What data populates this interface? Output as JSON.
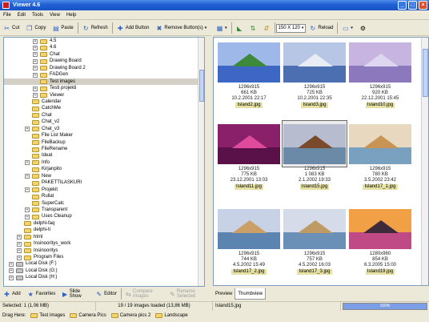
{
  "window": {
    "title": "Viewer 4.6"
  },
  "menu": [
    "File",
    "Edit",
    "Tools",
    "View",
    "Help"
  ],
  "toolbar_left": [
    {
      "label": "Cut",
      "icon": "scissors-icon",
      "glyph": "✂"
    },
    {
      "label": "Copy",
      "icon": "copy-icon",
      "glyph": "❐"
    },
    {
      "label": "Paste",
      "icon": "paste-icon",
      "glyph": "▤"
    },
    {
      "label": "Refresh",
      "icon": "refresh-icon",
      "glyph": "↻"
    },
    {
      "label": "Add Button",
      "icon": "add-button-icon",
      "glyph": "✚"
    },
    {
      "label": "Remove Button(s)",
      "icon": "remove-button-icon",
      "glyph": "✖"
    }
  ],
  "toolbar_right": {
    "size": "150 X 120",
    "reload": "Reload"
  },
  "tree": [
    {
      "label": "4.5",
      "lvl": 3,
      "exp": "+"
    },
    {
      "label": "4.6",
      "lvl": 3,
      "exp": "+"
    },
    {
      "label": "Chat",
      "lvl": 3,
      "exp": "+"
    },
    {
      "label": "Drawing Board",
      "lvl": 3,
      "exp": "+"
    },
    {
      "label": "Drawing Board 2",
      "lvl": 3,
      "exp": "+"
    },
    {
      "label": "FADGen",
      "lvl": 3,
      "exp": "+"
    },
    {
      "label": "Test images",
      "lvl": 3,
      "exp": "",
      "selected": true
    },
    {
      "label": "Testi projekti",
      "lvl": 3,
      "exp": "+"
    },
    {
      "label": "Viewer",
      "lvl": 3,
      "exp": "+"
    },
    {
      "label": "Calendar",
      "lvl": 2,
      "exp": ""
    },
    {
      "label": "CatchMe",
      "lvl": 2,
      "exp": ""
    },
    {
      "label": "Chat",
      "lvl": 2,
      "exp": ""
    },
    {
      "label": "Chat_v2",
      "lvl": 2,
      "exp": ""
    },
    {
      "label": "Chat_v3",
      "lvl": 2,
      "exp": "+"
    },
    {
      "label": "File List Maker",
      "lvl": 2,
      "exp": ""
    },
    {
      "label": "FileBackup",
      "lvl": 2,
      "exp": ""
    },
    {
      "label": "FileRename",
      "lvl": 2,
      "exp": ""
    },
    {
      "label": "Ideat",
      "lvl": 2,
      "exp": ""
    },
    {
      "label": "Info",
      "lvl": 2,
      "exp": "+"
    },
    {
      "label": "Kirjanpito",
      "lvl": 2,
      "exp": ""
    },
    {
      "label": "New",
      "lvl": 2,
      "exp": "+"
    },
    {
      "label": "PAKETTILASKURI",
      "lvl": 2,
      "exp": ""
    },
    {
      "label": "Projekit",
      "lvl": 2,
      "exp": "+"
    },
    {
      "label": "Rullat",
      "lvl": 2,
      "exp": ""
    },
    {
      "label": "SuperCalc",
      "lvl": 2,
      "exp": ""
    },
    {
      "label": "Transparent",
      "lvl": 2,
      "exp": "+"
    },
    {
      "label": "Uses Cleanup",
      "lvl": 2,
      "exp": "+"
    },
    {
      "label": "delphi-faq",
      "lvl": 1,
      "exp": ""
    },
    {
      "label": "delphi-ti",
      "lvl": 1,
      "exp": ""
    },
    {
      "label": "html",
      "lvl": 1,
      "exp": "+"
    },
    {
      "label": "Insinooritys_work",
      "lvl": 1,
      "exp": "+"
    },
    {
      "label": "Insinooritys",
      "lvl": 1,
      "exp": "+"
    },
    {
      "label": "Program Files",
      "lvl": 1,
      "exp": "+"
    },
    {
      "label": "Local Disk (F:)",
      "lvl": 0,
      "exp": "+",
      "drive": true
    },
    {
      "label": "Local Disk (G:)",
      "lvl": 0,
      "exp": "+",
      "drive": true
    },
    {
      "label": "Local Disk (H:)",
      "lvl": 0,
      "exp": "+",
      "drive": true
    }
  ],
  "thumbnails": [
    {
      "dims": "1296x915",
      "size": "661 KB",
      "date": "10.2.2001 22:17",
      "name": "Island2.jpg",
      "sky": "#9fb8ea",
      "sea": "#3e66c4",
      "land": "#3d8a3a"
    },
    {
      "dims": "1296x915",
      "size": "725 KB",
      "date": "10.2.2001 22:35",
      "name": "Island3.jpg",
      "sky": "#b8c6e6",
      "sea": "#4c6fb2",
      "land": "#e8ecf4"
    },
    {
      "dims": "1296x915",
      "size": "920 KB",
      "date": "22.12.2001 15:45",
      "name": "Island10.jpg",
      "sky": "#c8b4e0",
      "sea": "#8c78bc",
      "land": "#ddd6f0"
    },
    {
      "dims": "1296x915",
      "size": "775 KB",
      "date": "23.12.2001 13:03",
      "name": "Island11.jpg",
      "sky": "#8a1f6a",
      "sea": "#5a1048",
      "land": "#e04a9c"
    },
    {
      "dims": "1296x915",
      "size": "1 083 KB",
      "date": "2.1.2002 19:33",
      "name": "Island15.jpg",
      "sky": "#b7bccf",
      "sea": "#6a8aa8",
      "land": "#7a4a2a",
      "selected": true
    },
    {
      "dims": "1296x915",
      "size": "780 KB",
      "date": "3.5.2002 23:42",
      "name": "Island17_1.jpg",
      "sky": "#e9d8c0",
      "sea": "#7aa0c0",
      "land": "#c89454"
    },
    {
      "dims": "1296x915",
      "size": "744 KB",
      "date": "4.5.2002 15:49",
      "name": "Island17_2.jpg",
      "sky": "#c8d2e6",
      "sea": "#5c84b0",
      "land": "#caa066"
    },
    {
      "dims": "1296x915",
      "size": "757 KB",
      "date": "4.5.2002 16:03",
      "name": "Island17_3.jpg",
      "sky": "#d6dbea",
      "sea": "#6a90b8",
      "land": "#bf9a64"
    },
    {
      "dims": "1280x960",
      "size": "854 KB",
      "date": "6.3.2005 15:00",
      "name": "Island19.jpg",
      "sky": "#f2a046",
      "sea": "#c04a86",
      "land": "#3d2a3a"
    }
  ],
  "bottom_left": [
    {
      "label": "Add",
      "icon": "add-icon",
      "glyph": "✚",
      "disabled": false
    },
    {
      "label": "Favorites",
      "icon": "favorites-icon",
      "glyph": "★",
      "disabled": false
    },
    {
      "label": "Slide Show",
      "icon": "slideshow-icon",
      "glyph": "▶",
      "disabled": false
    },
    {
      "label": "Editor",
      "icon": "editor-icon",
      "glyph": "✎",
      "disabled": false
    },
    {
      "label": "Compare Images",
      "icon": "compare-icon",
      "glyph": "⇆",
      "disabled": true
    },
    {
      "label": "Rename Selected",
      "icon": "rename-icon",
      "glyph": "✎",
      "disabled": true
    }
  ],
  "tabs": [
    {
      "label": "Preview",
      "active": false
    },
    {
      "label": "Thumbview",
      "active": true
    }
  ],
  "status": {
    "selected": "Selected: 1 (1,06 MB)",
    "loaded": "19 / 19 images loaded (13,86 MB)",
    "file": "Island15.jpg",
    "progress_percent": 100,
    "progress_label": "100%"
  },
  "dragbar": {
    "label": "Drag Here:",
    "targets": [
      "Test images",
      "Camera Pics",
      "Camera pics 2",
      "Landscape"
    ]
  }
}
